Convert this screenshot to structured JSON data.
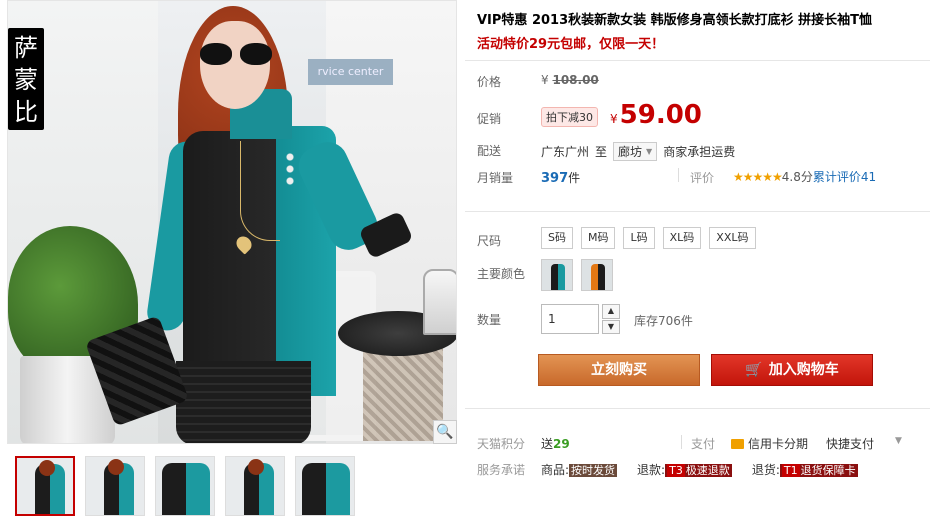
{
  "gallery": {
    "brand_chars": [
      "萨",
      "蒙",
      "比"
    ],
    "sign_text": "rvice center",
    "zoom_icon": "magnifier-icon",
    "thumbnail_count": 5
  },
  "product": {
    "title": "VIP特惠 2013秋装新款女装 韩版修身高领长款打底衫 拼接长袖T恤",
    "promo": "活动特价29元包邮，仅限一天！"
  },
  "price": {
    "label": "价格",
    "currency": "¥",
    "original": "108.00",
    "promo_label": "促销",
    "promo_tag": "拍下减30",
    "current": "59.00"
  },
  "shipping": {
    "label": "配送",
    "from": "广东广州",
    "to_word": "至",
    "destination": "廊坊",
    "fee_note": "商家承担运费"
  },
  "sales": {
    "label": "月销量",
    "count": "397",
    "unit": "件",
    "rating_label": "评价",
    "stars": "★★★★★",
    "score": "4.8分",
    "review_link": "累计评价41"
  },
  "options": {
    "size_label": "尺码",
    "sizes": [
      "S码",
      "M码",
      "L码",
      "XL码",
      "XXL码"
    ],
    "color_label": "主要颜色",
    "quantity_label": "数量",
    "quantity_value": "1",
    "stock": "库存706件"
  },
  "actions": {
    "buy_now": "立刻购买",
    "add_to_cart": "加入购物车",
    "cart_icon": "cart-icon"
  },
  "extras": {
    "points_label": "天猫积分",
    "points_prefix": "送",
    "points_value": "29",
    "pay_label": "支付",
    "card_icon": "credit-card-icon",
    "installment": "信用卡分期",
    "quick_pay": "快捷支付",
    "service_label": "服务承诺",
    "service_goods_prefix": "商品:",
    "service_goods_tag": "按时发货",
    "service_refund_prefix": "退款:",
    "service_refund_code": "T3",
    "service_refund_tag": "极速退款",
    "service_return_prefix": "退货:",
    "service_return_code": "T1",
    "service_return_tag": "退货保障卡"
  },
  "colors": {
    "accent_red": "#c40000",
    "buy_orange": "#d57a3a",
    "link_blue": "#1a6bb5"
  }
}
